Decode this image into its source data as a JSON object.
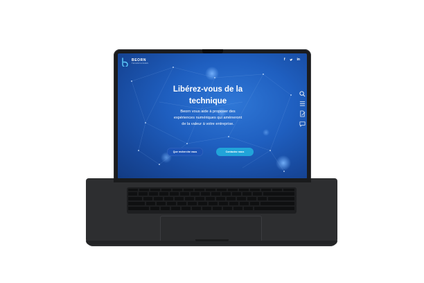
{
  "brand": {
    "name": "BEORN",
    "tagline": "TECHNOLOGIES"
  },
  "social": {
    "facebook": "f",
    "twitter": "t",
    "linkedin": "in"
  },
  "hero": {
    "title_line1": "Libérez-vous de la",
    "title_line2": "technique",
    "text_line1": "Beorn  vous aide à proposer des",
    "text_line2": "expériences numériques qui amèneront",
    "text_line3": "de la valeur à votre entreprise."
  },
  "buttons": {
    "primary_label": "Que recherche vous",
    "secondary_label": "Contactez nous"
  },
  "side_icons": [
    "search-icon",
    "menu-icon",
    "edit-icon",
    "chat-icon"
  ],
  "colors": {
    "screen_bg": "#1f5fc0",
    "accent": "#21a4d9",
    "laptop_body": "#2d2e30"
  }
}
